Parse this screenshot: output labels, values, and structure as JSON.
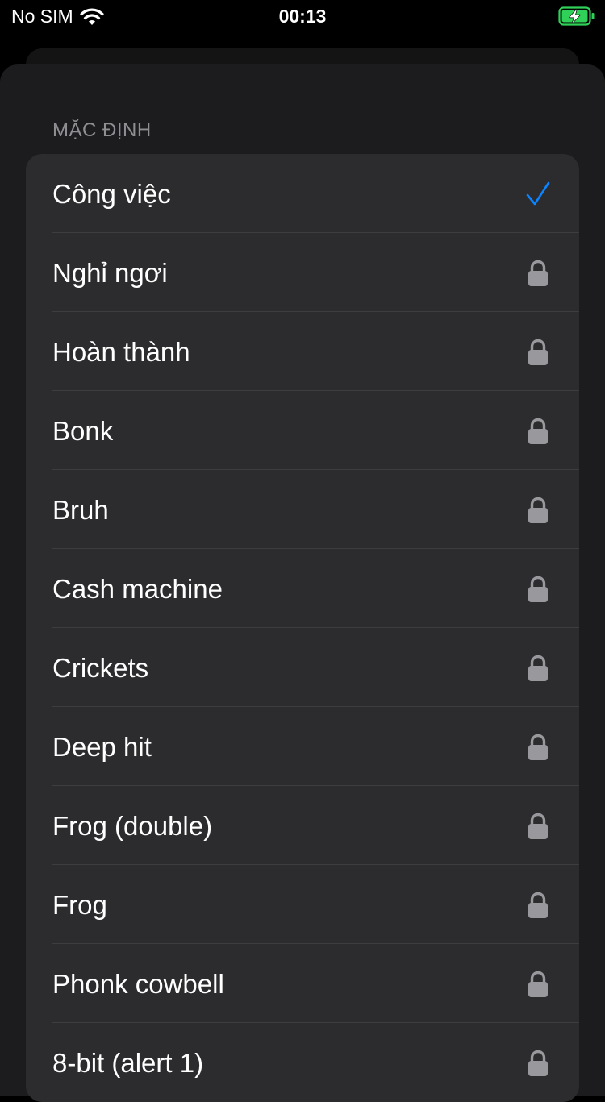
{
  "status_bar": {
    "carrier": "No SIM",
    "time": "00:13"
  },
  "colors": {
    "accent": "#0a84ff",
    "battery": "#30d158",
    "lock": "#98989d",
    "background": "#1c1c1e",
    "row_background": "#2c2c2e"
  },
  "section": {
    "header": "MẶC ĐỊNH"
  },
  "sounds": [
    {
      "label": "Công việc",
      "state": "selected",
      "icon": "checkmark-icon"
    },
    {
      "label": "Nghỉ ngơi",
      "state": "locked",
      "icon": "lock-icon"
    },
    {
      "label": "Hoàn thành",
      "state": "locked",
      "icon": "lock-icon"
    },
    {
      "label": "Bonk",
      "state": "locked",
      "icon": "lock-icon"
    },
    {
      "label": "Bruh",
      "state": "locked",
      "icon": "lock-icon"
    },
    {
      "label": "Cash machine",
      "state": "locked",
      "icon": "lock-icon"
    },
    {
      "label": "Crickets",
      "state": "locked",
      "icon": "lock-icon"
    },
    {
      "label": "Deep hit",
      "state": "locked",
      "icon": "lock-icon"
    },
    {
      "label": "Frog (double)",
      "state": "locked",
      "icon": "lock-icon"
    },
    {
      "label": "Frog",
      "state": "locked",
      "icon": "lock-icon"
    },
    {
      "label": "Phonk cowbell",
      "state": "locked",
      "icon": "lock-icon"
    },
    {
      "label": "8-bit (alert 1)",
      "state": "locked",
      "icon": "lock-icon"
    }
  ]
}
